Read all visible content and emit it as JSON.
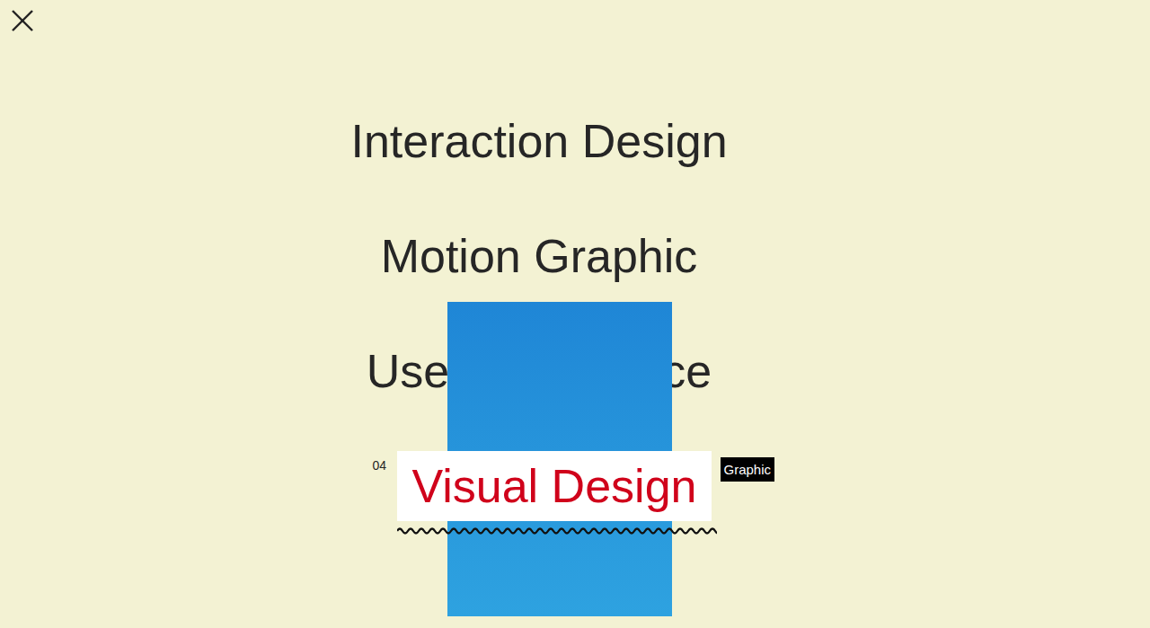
{
  "close": {
    "icon": "×"
  },
  "menu": {
    "items": [
      {
        "label": "Interaction Design",
        "selected": false
      },
      {
        "label": "Motion Graphic",
        "selected": false
      },
      {
        "label": "User Experience",
        "selected": false
      },
      {
        "label": "Visual Design",
        "selected": true,
        "number": "04",
        "tag": "Graphic"
      }
    ]
  }
}
